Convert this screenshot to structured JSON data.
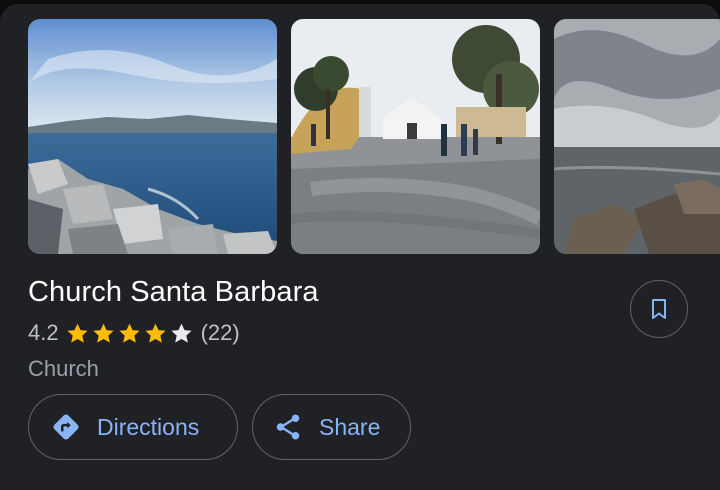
{
  "place": {
    "name": "Church Santa Barbara",
    "rating": "4.2",
    "rating_stars": 4.2,
    "review_count": "(22)",
    "category": "Church"
  },
  "photos": [
    {
      "name": "photo-sea-rocks"
    },
    {
      "name": "photo-church-square"
    },
    {
      "name": "photo-cloudy-shore"
    }
  ],
  "actions": {
    "directions_label": "Directions",
    "share_label": "Share"
  },
  "colors": {
    "background": "#202124",
    "accent": "#8ab4f8",
    "star": "#fbbc04",
    "outline": "#5f6368"
  },
  "icons": {
    "save": "bookmark-icon",
    "directions": "directions-icon",
    "share": "share-icon",
    "star": "star-icon"
  }
}
